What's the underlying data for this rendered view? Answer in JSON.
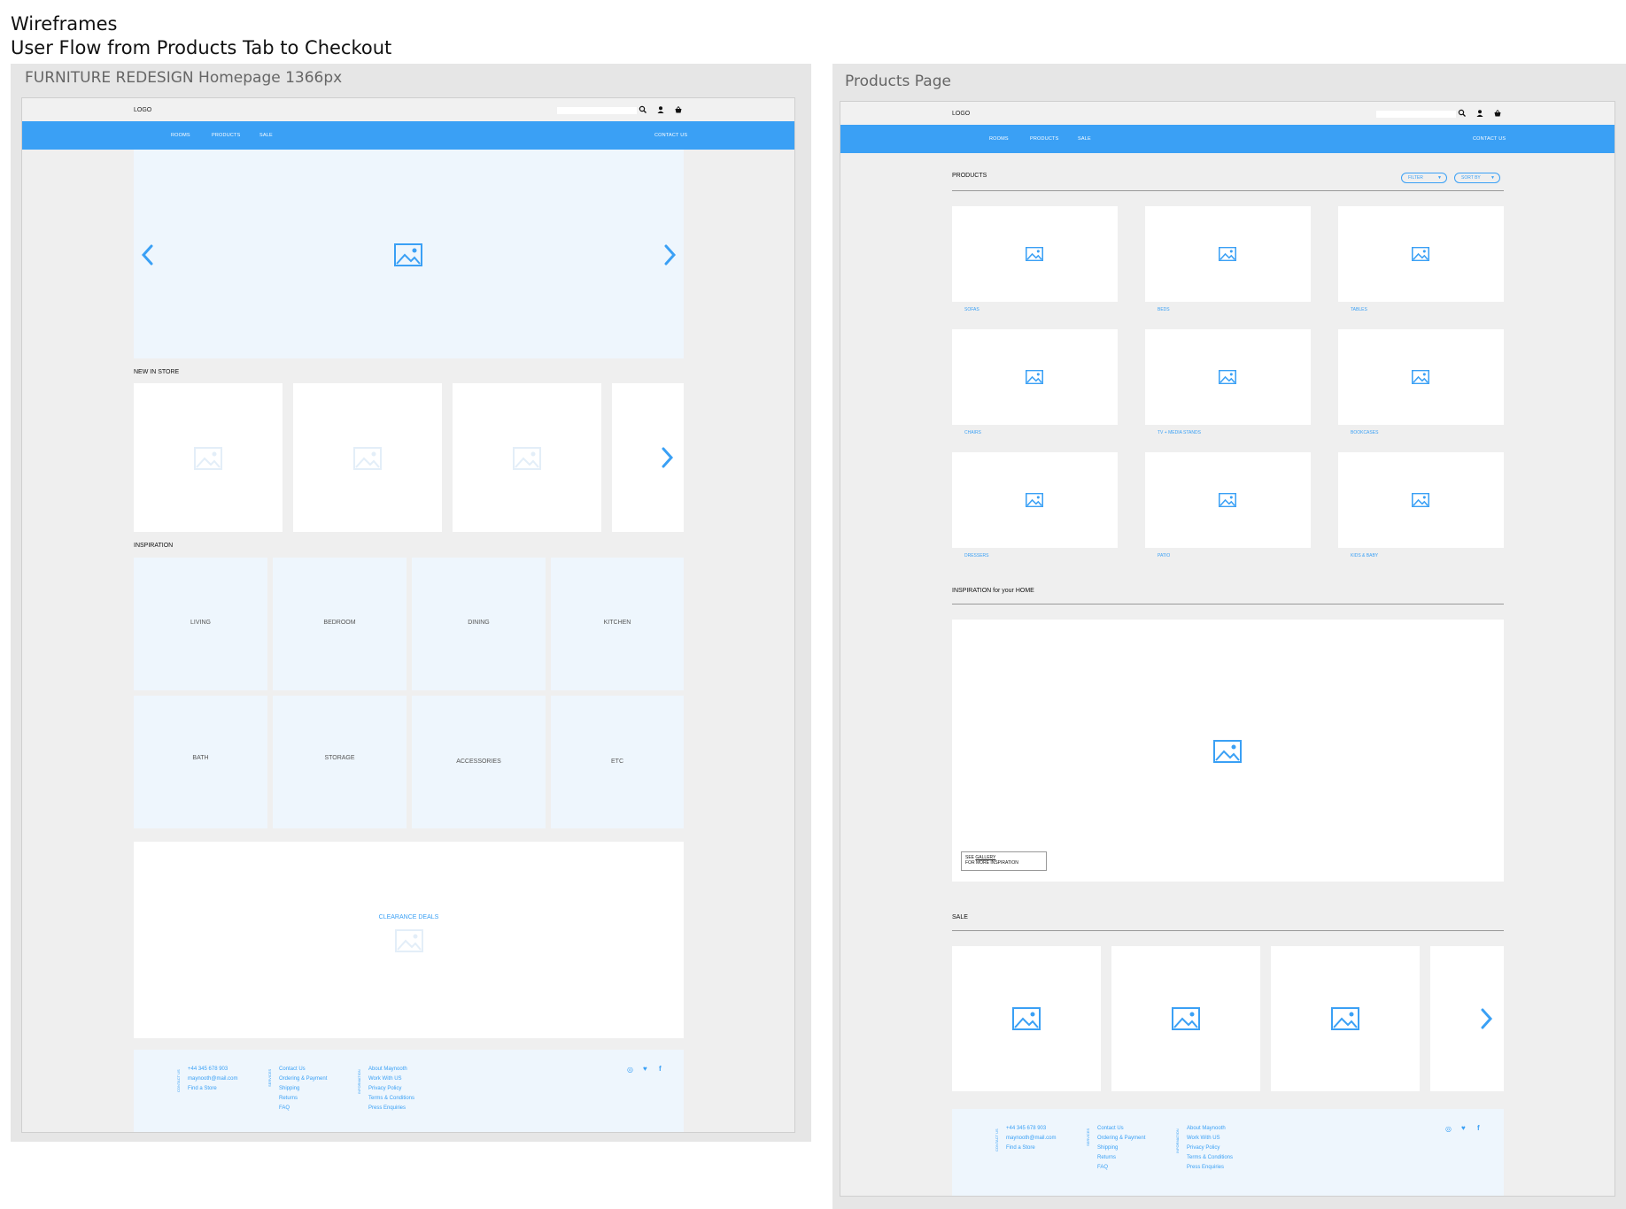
{
  "header": {
    "line1": "Wireframes",
    "line2": "User Flow from Products Tab to Checkout"
  },
  "homepage": {
    "board_title": "FURNITURE REDESIGN Homepage 1366px",
    "logo": "LOGO",
    "nav": [
      "ROOMS",
      "PRODUCTS",
      "SALE"
    ],
    "contact": "CONTACT US",
    "new_in_store": "NEW IN STORE",
    "inspiration": "INSPIRATION",
    "rooms": [
      "LIVING",
      "BEDROOM",
      "DINING",
      "KITCHEN",
      "BATH",
      "STORAGE",
      "ACCESSORIES",
      "ETC"
    ],
    "clearance": "CLEARANCE DEALS"
  },
  "products_page": {
    "board_title": "Products Page",
    "logo": "LOGO",
    "nav": [
      "ROOMS",
      "PRODUCTS",
      "SALE"
    ],
    "contact": "CONTACT US",
    "products_heading": "PRODUCTS",
    "filter": "FILTER",
    "sort": "SORT BY",
    "categories": [
      "SOFAS",
      "BEDS",
      "TABLES",
      "CHAIRS",
      "TV + MEDIA STANDS",
      "BOOKCASES",
      "DRESSERS",
      "PATIO",
      "KIDS & BABY"
    ],
    "inspiration_heading": "INSPIRATION for your HOME",
    "gallery_line1_prefix": "SEE ",
    "gallery_link": "GALLERY",
    "gallery_line2": "FOR MORE INSPIRATION",
    "sale_heading": "SALE"
  },
  "footer": {
    "contact_label": "CONTACT US",
    "services_label": "SERVICES",
    "information_label": "INFORMATION",
    "contact": [
      "+44 345 678 903",
      "maynooth@mail.com",
      "Find a Store"
    ],
    "services": [
      "Contact Us",
      "Ordering & Payment",
      "Shipping",
      "Returns",
      "FAQ"
    ],
    "information": [
      "About Maynooth",
      "Work With US",
      "Privacy Policy",
      "Terms & Conditions",
      "Press Enquiries"
    ]
  },
  "icons": {
    "image": "image-placeholder-icon",
    "search": "search-icon",
    "account": "user-icon",
    "cart": "basket-icon",
    "chevron_left": "chevron-left-icon",
    "chevron_right": "chevron-right-icon",
    "instagram": "instagram-icon",
    "twitter": "twitter-icon",
    "facebook": "facebook-icon"
  },
  "colors": {
    "accent": "#3aa0f5",
    "board": "#e6e6e6",
    "frame": "#efefef",
    "light_tile": "#eef6fd"
  }
}
